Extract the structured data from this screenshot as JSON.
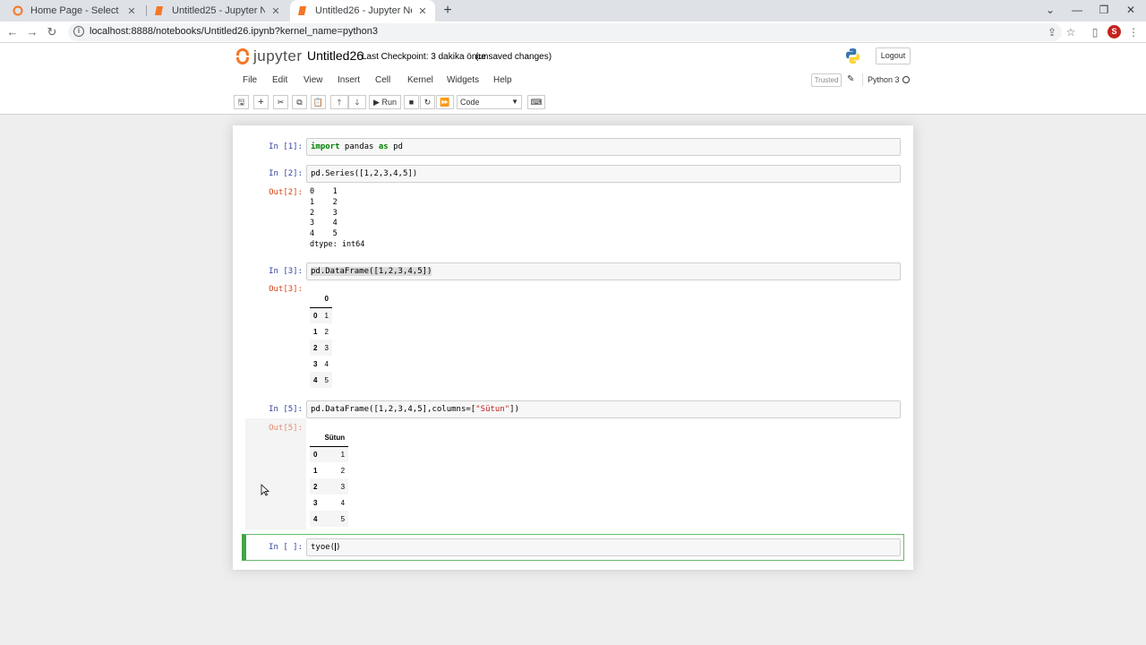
{
  "browser": {
    "tabs": [
      {
        "label": "Home Page - Select or create a n",
        "active": false
      },
      {
        "label": "Untitled25 - Jupyter Notebook",
        "active": false
      },
      {
        "label": "Untitled26 - Jupyter Notebook",
        "active": true
      }
    ],
    "url": "localhost:8888/notebooks/Untitled26.ipynb?kernel_name=python3",
    "avatar_letter": "S"
  },
  "header": {
    "logo_text": "jupyter",
    "notebook_name": "Untitled26",
    "checkpoint": "Last Checkpoint: 3 dakika önce",
    "status": "(unsaved changes)",
    "logout_label": "Logout",
    "menu": [
      "File",
      "Edit",
      "View",
      "Insert",
      "Cell",
      "Kernel",
      "Widgets",
      "Help"
    ],
    "trusted_label": "Trusted",
    "kernel_name": "Python 3",
    "run_label": "Run",
    "cell_type": "Code"
  },
  "cells": {
    "c1": {
      "prompt": "In [1]:",
      "kw1": "import",
      "t1": " pandas ",
      "kw2": "as",
      "t2": " pd"
    },
    "c2": {
      "prompt": "In [2]:",
      "code": "pd.Series([1,2,3,4,5])",
      "out_prompt": "Out[2]:",
      "output": "0    1\n1    2\n2    3\n3    4\n4    5\ndtype: int64"
    },
    "c3": {
      "prompt": "In [3]:",
      "code": "pd.DataFrame([1,2,3,4,5])",
      "out_prompt": "Out[3]:",
      "col": "0",
      "rows": [
        [
          "0",
          "1"
        ],
        [
          "1",
          "2"
        ],
        [
          "2",
          "3"
        ],
        [
          "3",
          "4"
        ],
        [
          "4",
          "5"
        ]
      ]
    },
    "c4": {
      "prompt": "In [5]:",
      "code_pre": "pd.DataFrame([1,2,3,4,5],columns=[",
      "code_str": "\"Sütun\"",
      "code_post": "])",
      "out_prompt": "Out[5]:",
      "col": "Sütun",
      "rows": [
        [
          "0",
          "1"
        ],
        [
          "1",
          "2"
        ],
        [
          "2",
          "3"
        ],
        [
          "3",
          "4"
        ],
        [
          "4",
          "5"
        ]
      ]
    },
    "c5": {
      "prompt": "In [ ]:",
      "code_a": "tyoe(",
      "code_b": ")"
    }
  }
}
